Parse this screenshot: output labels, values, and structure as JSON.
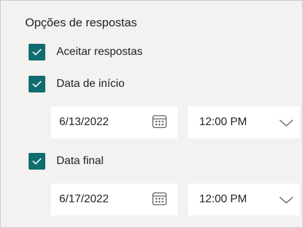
{
  "colors": {
    "accent": "#0f6c6f",
    "panel_bg": "#f3f2f1",
    "field_bg": "#ffffff",
    "text": "#201f1e"
  },
  "section_title": "Opções de respostas",
  "options": [
    {
      "label": "Aceitar respostas",
      "checked": true
    },
    {
      "label": "Data de início",
      "checked": true
    },
    {
      "label": "Data final",
      "checked": true
    }
  ],
  "start": {
    "date": "6/13/2022",
    "date_icon": "calendar-icon",
    "time": "12:00 PM",
    "time_icon": "chevron-down-icon"
  },
  "end": {
    "date": "6/17/2022",
    "date_icon": "calendar-icon",
    "time": "12:00 PM",
    "time_icon": "chevron-down-icon"
  }
}
